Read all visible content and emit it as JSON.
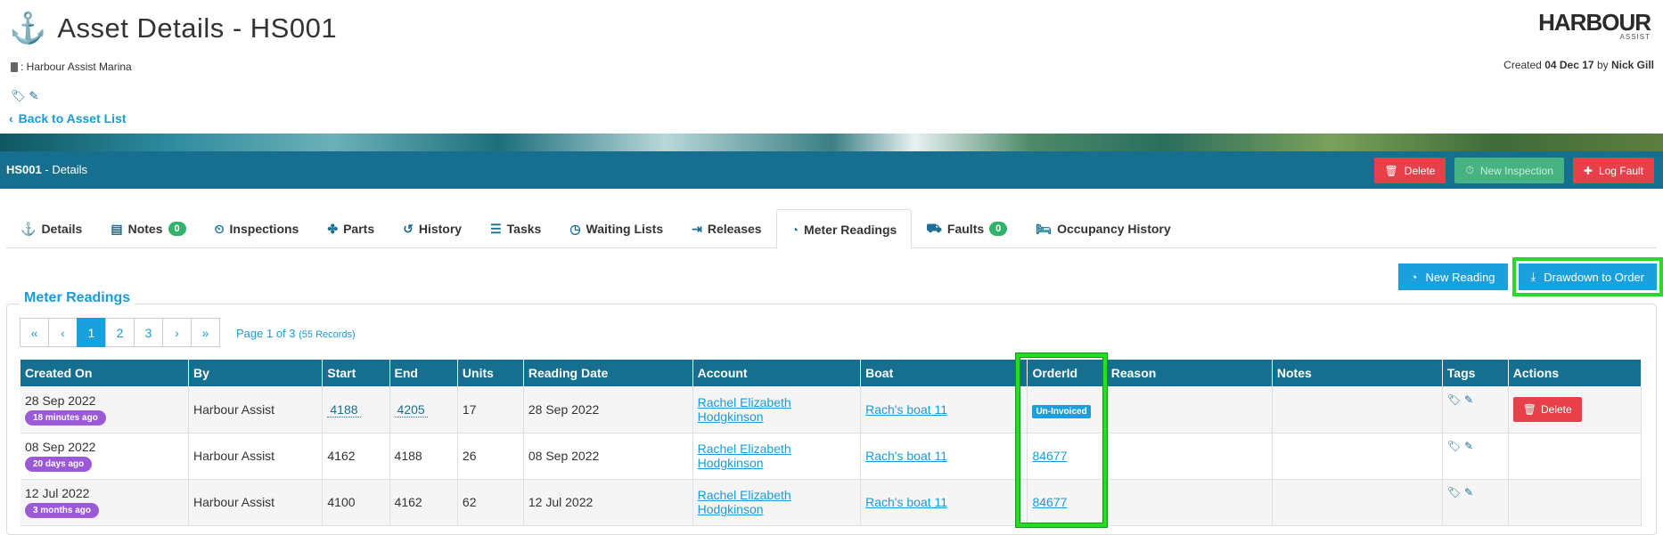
{
  "header": {
    "title": "Asset Details - HS001",
    "title_icon": "anchor-icon",
    "location": ": Harbour Assist Marina",
    "back_link": "Back to Asset List",
    "logo_main": "HARBOUR",
    "logo_sub": "ASSIST",
    "created_prefix": "Created",
    "created_date": "04 Dec 17",
    "created_by_word": "by",
    "created_by": "Nick Gill"
  },
  "details_bar": {
    "asset_code": "HS001",
    "suffix": "- Details",
    "buttons": [
      {
        "label": "Delete",
        "icon": "trash-icon",
        "color": "#e7404a"
      },
      {
        "label": "New Inspection",
        "icon": "inspection-icon",
        "color": "#47b383"
      },
      {
        "label": "Log Fault",
        "icon": "first-aid-icon",
        "color": "#e7404a"
      }
    ]
  },
  "tabs": [
    {
      "label": "Details",
      "icon": "anchor-icon"
    },
    {
      "label": "Notes",
      "icon": "note-icon",
      "badge": "0"
    },
    {
      "label": "Inspections",
      "icon": "clock-icon"
    },
    {
      "label": "Parts",
      "icon": "puzzle-icon"
    },
    {
      "label": "History",
      "icon": "history-icon"
    },
    {
      "label": "Tasks",
      "icon": "tasks-icon"
    },
    {
      "label": "Waiting Lists",
      "icon": "clock-icon"
    },
    {
      "label": "Releases",
      "icon": "release-icon"
    },
    {
      "label": "Meter Readings",
      "icon": "meter-icon",
      "active": true
    },
    {
      "label": "Faults",
      "icon": "ambulance-icon",
      "badge": "0"
    },
    {
      "label": "Occupancy History",
      "icon": "bed-icon"
    }
  ],
  "actions": {
    "new_reading": "New Reading",
    "drawdown": "Drawdown to Order"
  },
  "panel": {
    "title": "Meter Readings"
  },
  "pagination": {
    "first": "«",
    "prev": "‹",
    "pages": [
      "1",
      "2",
      "3"
    ],
    "next": "›",
    "last": "»",
    "info": "Page 1 of 3",
    "records": "(55 Records)"
  },
  "table": {
    "columns": [
      "Created On",
      "By",
      "Start",
      "End",
      "Units",
      "Reading Date",
      "Account",
      "Boat",
      "OrderId",
      "Reason",
      "Notes",
      "Tags",
      "Actions"
    ],
    "rows": [
      {
        "created": "28 Sep 2022",
        "ago": "18 minutes ago",
        "by": "Harbour Assist",
        "start": "4188",
        "end": "4205",
        "units": "17",
        "reading_date": "28 Sep 2022",
        "account": "Rachel Elizabeth Hodgkinson",
        "boat": "Rach's boat 11",
        "order": "Un-Invoiced",
        "reason": "",
        "notes": "",
        "action": "Delete"
      },
      {
        "created": "08 Sep 2022",
        "ago": "20 days ago",
        "by": "Harbour Assist",
        "start": "4162",
        "end": "4188",
        "units": "26",
        "reading_date": "08 Sep 2022",
        "account": "Rachel Elizabeth Hodgkinson",
        "boat": "Rach's boat 11",
        "order": "84677",
        "reason": "",
        "notes": "",
        "action": ""
      },
      {
        "created": "12 Jul 2022",
        "ago": "3 months ago",
        "by": "Harbour Assist",
        "start": "4100",
        "end": "4162",
        "units": "62",
        "reading_date": "12 Jul 2022",
        "account": "Rachel Elizabeth Hodgkinson",
        "boat": "Rach's boat 11",
        "order": "84677",
        "reason": "",
        "notes": "",
        "action": ""
      }
    ]
  }
}
